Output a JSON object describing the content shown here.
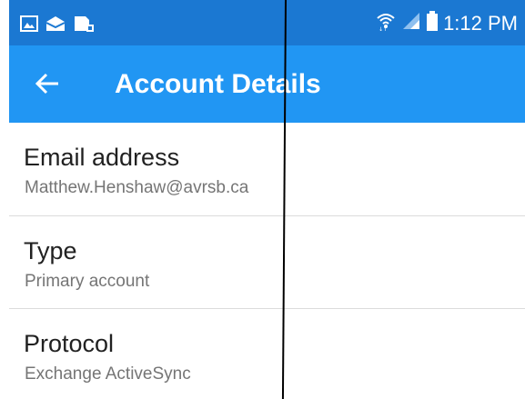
{
  "status_bar": {
    "time": "1:12 PM",
    "left_icons": [
      "gallery-icon",
      "mail-icon",
      "sd-card-icon"
    ],
    "right_icons": [
      "wifi-icon",
      "signal-icon",
      "battery-icon"
    ]
  },
  "app_bar": {
    "title": "Account Details",
    "back_icon": "arrow-back-icon"
  },
  "fields": [
    {
      "label": "Email address",
      "value": "Matthew.Henshaw@avrsb.ca"
    },
    {
      "label": "Type",
      "value": "Primary account"
    },
    {
      "label": "Protocol",
      "value": "Exchange ActiveSync"
    }
  ],
  "colors": {
    "status_bar": "#1b78d2",
    "app_bar": "#2196f3",
    "label_text": "#212121",
    "value_text": "#757575",
    "divider": "#dcdcdc"
  }
}
